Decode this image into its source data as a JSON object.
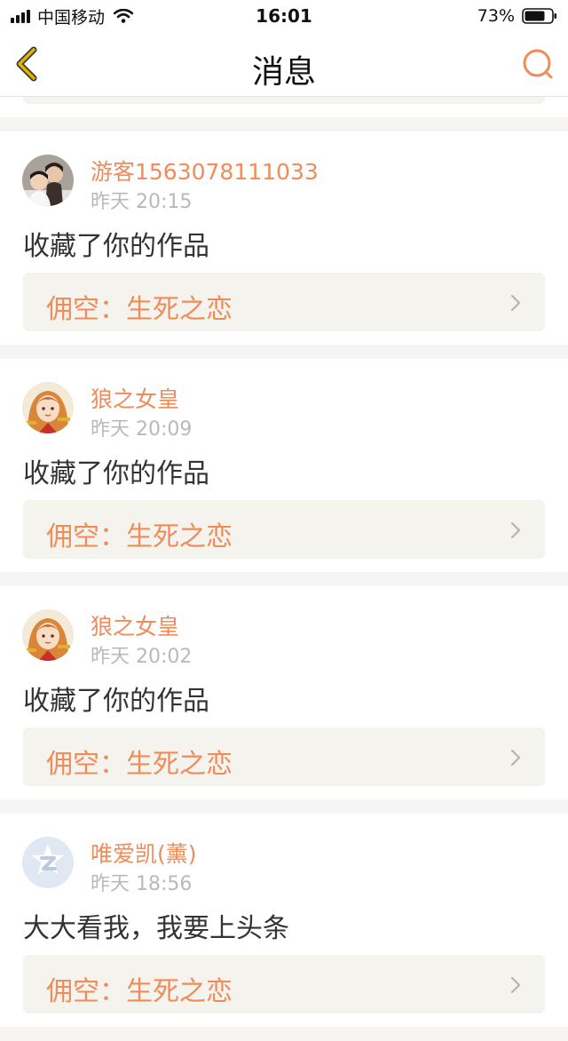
{
  "status_bar": {
    "carrier": "中国移动",
    "time": "16:01",
    "battery": "73%"
  },
  "nav": {
    "title": "消息",
    "back_icon": "chevron-left-icon",
    "search_icon": "search-icon"
  },
  "colors": {
    "accent": "#ef8c5a",
    "back_icon": "#e0b400",
    "card_bg": "#f4f3ee",
    "page_bg": "#f6f5f3"
  },
  "messages": [
    {
      "username": "游客1563078111033",
      "time": "昨天 20:15",
      "action": "收藏了你的作品",
      "work_title": "佣空：生死之恋"
    },
    {
      "username": "狼之女皇",
      "time": "昨天 20:09",
      "action": "收藏了你的作品",
      "work_title": "佣空：生死之恋"
    },
    {
      "username": "狼之女皇",
      "time": "昨天 20:02",
      "action": "收藏了你的作品",
      "work_title": "佣空：生死之恋"
    },
    {
      "username": "唯爱凯(薰)",
      "time": "昨天 18:56",
      "action": "大大看我，我要上头条",
      "work_title": "佣空：生死之恋"
    }
  ]
}
